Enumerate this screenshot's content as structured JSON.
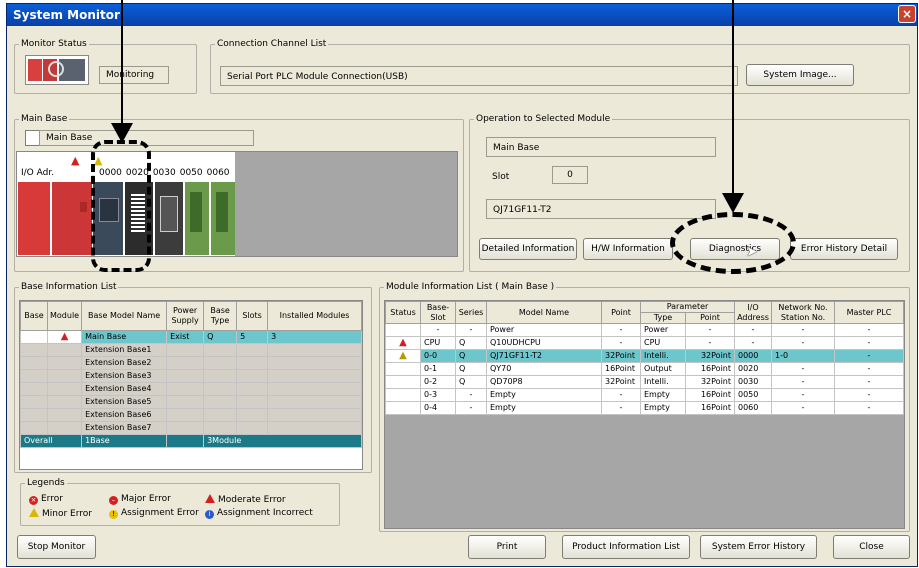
{
  "window": {
    "title": "System Monitor",
    "close_label": "×"
  },
  "monitor_status": {
    "legend": "Monitor Status",
    "state": "Monitoring"
  },
  "connection": {
    "legend": "Connection Channel List",
    "value": "Serial Port  PLC Module Connection(USB)",
    "system_image_button": "System Image..."
  },
  "main_base": {
    "legend": "Main Base",
    "field": "Main Base",
    "io_adr_label": "I/O Adr.",
    "io_addresses": [
      "0000",
      "0020",
      "0030",
      "0050",
      "0060"
    ]
  },
  "operation": {
    "legend": "Operation to Selected Module",
    "base": "Main Base",
    "slot_label": "Slot",
    "slot_value": "0",
    "module": "QJ71GF11-T2",
    "buttons": {
      "detailed": "Detailed Information",
      "hw": "H/W Information",
      "diagnostics": "Diagnostics",
      "error_history": "Error History Detail"
    }
  },
  "base_info": {
    "legend": "Base Information List",
    "headers": [
      "Base",
      "Module",
      "Base Model Name",
      "Power Supply",
      "Base Type",
      "Slots",
      "Installed Modules"
    ],
    "rows": [
      {
        "base": "",
        "module": "▲",
        "name": "Main Base",
        "power": "Exist",
        "type": "Q",
        "slots": "5",
        "installed": "3"
      },
      {
        "base": "",
        "module": "",
        "name": "Extension Base1",
        "power": "",
        "type": "",
        "slots": "",
        "installed": ""
      },
      {
        "base": "",
        "module": "",
        "name": "Extension Base2",
        "power": "",
        "type": "",
        "slots": "",
        "installed": ""
      },
      {
        "base": "",
        "module": "",
        "name": "Extension Base3",
        "power": "",
        "type": "",
        "slots": "",
        "installed": ""
      },
      {
        "base": "",
        "module": "",
        "name": "Extension Base4",
        "power": "",
        "type": "",
        "slots": "",
        "installed": ""
      },
      {
        "base": "",
        "module": "",
        "name": "Extension Base5",
        "power": "",
        "type": "",
        "slots": "",
        "installed": ""
      },
      {
        "base": "",
        "module": "",
        "name": "Extension Base6",
        "power": "",
        "type": "",
        "slots": "",
        "installed": ""
      },
      {
        "base": "",
        "module": "",
        "name": "Extension Base7",
        "power": "",
        "type": "",
        "slots": "",
        "installed": ""
      }
    ],
    "overall": {
      "label": "Overall",
      "bases": "1Base",
      "modules": "3Module"
    }
  },
  "legends": {
    "legend": "Legends",
    "items": [
      "Error",
      "Major Error",
      "Moderate Error",
      "Minor Error",
      "Assignment Error",
      "Assignment Incorrect"
    ]
  },
  "module_info": {
    "legend": "Module Information List ( Main Base )",
    "headers": {
      "status": "Status",
      "slot": "Base-Slot",
      "series": "Series",
      "model": "Model Name",
      "point": "Point",
      "parameter": "Parameter",
      "ptype": "Type",
      "ppoint": "Point",
      "io": "I/O Address",
      "network": "Network No. Station No.",
      "master": "Master PLC"
    },
    "rows": [
      {
        "status": "",
        "slot": "-",
        "series": "-",
        "model": "Power",
        "point": "-",
        "ptype": "Power",
        "ppoint": "-",
        "io": "-",
        "network": "-",
        "master": "-"
      },
      {
        "status": "error",
        "slot": "CPU",
        "series": "Q",
        "model": "Q10UDHCPU",
        "point": "-",
        "ptype": "CPU",
        "ppoint": "-",
        "io": "-",
        "network": "-",
        "master": "-"
      },
      {
        "status": "minor",
        "slot": "0-0",
        "series": "Q",
        "model": "QJ71GF11-T2",
        "point": "32Point",
        "ptype": "Intelli.",
        "ppoint": "32Point",
        "io": "0000",
        "network": "1-0",
        "master": "-"
      },
      {
        "status": "",
        "slot": "0-1",
        "series": "Q",
        "model": "QY70",
        "point": "16Point",
        "ptype": "Output",
        "ppoint": "16Point",
        "io": "0020",
        "network": "-",
        "master": "-"
      },
      {
        "status": "",
        "slot": "0-2",
        "series": "Q",
        "model": "QD70P8",
        "point": "32Point",
        "ptype": "Intelli.",
        "ppoint": "32Point",
        "io": "0030",
        "network": "-",
        "master": "-"
      },
      {
        "status": "",
        "slot": "0-3",
        "series": "-",
        "model": "Empty",
        "point": "-",
        "ptype": "Empty",
        "ppoint": "16Point",
        "io": "0050",
        "network": "-",
        "master": "-"
      },
      {
        "status": "",
        "slot": "0-4",
        "series": "-",
        "model": "Empty",
        "point": "-",
        "ptype": "Empty",
        "ppoint": "16Point",
        "io": "0060",
        "network": "-",
        "master": "-"
      }
    ]
  },
  "bottom": {
    "stop_monitor": "Stop Monitor",
    "print": "Print",
    "product_info": "Product Information List",
    "system_error_history": "System Error History",
    "close": "Close"
  },
  "colors": {
    "title_bar": "#0a5fd8",
    "selected_row": "#6cc6cc",
    "overall_row": "#1c7a88",
    "window_bg": "#ece9d8"
  }
}
